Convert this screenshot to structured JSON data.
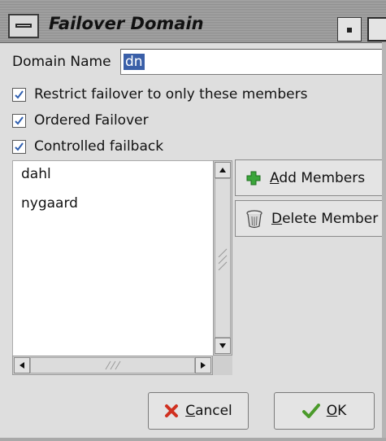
{
  "window": {
    "title": "Failover Domain"
  },
  "form": {
    "domain_name_label": "Domain Name",
    "domain_name_value": "dn",
    "checkboxes": [
      {
        "label": "Restrict failover to only these members",
        "checked": true
      },
      {
        "label": "Ordered Failover",
        "checked": true
      },
      {
        "label": "Controlled failback",
        "checked": true
      }
    ]
  },
  "members": {
    "items": [
      "dahl",
      "nygaard"
    ],
    "add_button": {
      "mnemonic": "A",
      "rest": "dd Members"
    },
    "delete_button": {
      "mnemonic": "D",
      "rest": "elete Member"
    }
  },
  "dialog_buttons": {
    "cancel": {
      "mnemonic": "C",
      "rest": "ancel"
    },
    "ok": {
      "mnemonic": "O",
      "rest": "K"
    }
  },
  "colors": {
    "selection": "#3a5fa8",
    "check": "#2f5fb0",
    "add_icon": "#3aa53a",
    "cancel_icon": "#d03020",
    "ok_icon": "#4a9a2a"
  }
}
